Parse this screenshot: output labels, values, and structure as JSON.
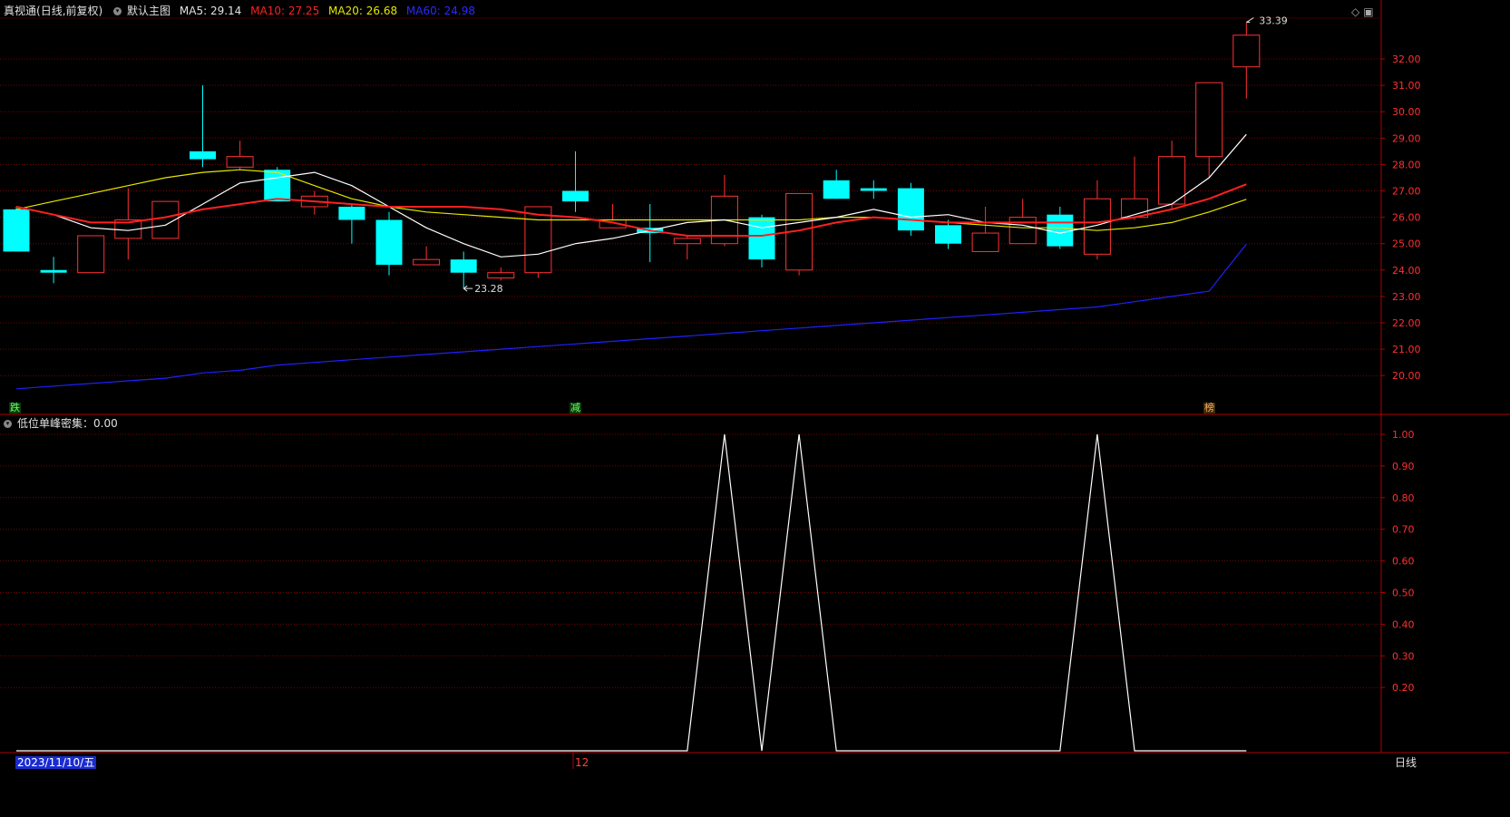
{
  "header": {
    "stock_name": "真视通",
    "adjust_mode": "(日线,前复权)",
    "template_name": "默认主图",
    "ma5_label": "MA5:",
    "ma5_value": "29.14",
    "ma10_label": "MA10:",
    "ma10_value": "27.25",
    "ma20_label": "MA20:",
    "ma20_value": "26.68",
    "ma60_label": "MA60:",
    "ma60_value": "24.98"
  },
  "indicator": {
    "label": "低位单峰密集：0.00"
  },
  "annotations": {
    "high_label": "33.39",
    "low_label": "23.28"
  },
  "signals": {
    "s1": "跌",
    "s2": "减",
    "s3": "榜"
  },
  "footer": {
    "date": "2023/11/10/五",
    "month_tick": "12",
    "period": "日线"
  },
  "colors": {
    "background": "#000000",
    "up": "#ff3232",
    "down": "#00ffff",
    "ma5": "#ffffff",
    "ma10": "#ff2020",
    "ma20": "#e6e600",
    "ma60": "#2020ff",
    "grid": "#7a0000",
    "axis": "#b00000"
  },
  "chart_data": {
    "type": "candlestick",
    "price_axis": {
      "ticks": [
        "32.00",
        "31.00",
        "30.00",
        "29.00",
        "28.00",
        "27.00",
        "26.00",
        "25.00",
        "24.00",
        "23.00",
        "22.00",
        "21.00",
        "20.00"
      ]
    },
    "indicator_axis": {
      "ticks": [
        "1.00",
        "0.90",
        "0.80",
        "0.70",
        "0.60",
        "0.50",
        "0.40",
        "0.30",
        "0.20"
      ]
    },
    "candles": [
      {
        "o": 26.3,
        "h": 26.4,
        "l": 24.7,
        "c": 24.7
      },
      {
        "o": 24.0,
        "h": 24.5,
        "l": 23.5,
        "c": 23.9
      },
      {
        "o": 23.9,
        "h": 25.3,
        "l": 23.9,
        "c": 25.3
      },
      {
        "o": 25.2,
        "h": 27.1,
        "l": 24.4,
        "c": 25.9
      },
      {
        "o": 25.2,
        "h": 26.6,
        "l": 25.2,
        "c": 26.6
      },
      {
        "o": 28.5,
        "h": 31.0,
        "l": 27.9,
        "c": 28.2
      },
      {
        "o": 27.9,
        "h": 28.9,
        "l": 27.8,
        "c": 28.3
      },
      {
        "o": 27.8,
        "h": 27.9,
        "l": 26.6,
        "c": 26.6
      },
      {
        "o": 26.4,
        "h": 27.0,
        "l": 26.1,
        "c": 26.8
      },
      {
        "o": 26.4,
        "h": 26.5,
        "l": 25.0,
        "c": 25.9
      },
      {
        "o": 25.9,
        "h": 26.2,
        "l": 23.8,
        "c": 24.2
      },
      {
        "o": 24.2,
        "h": 24.9,
        "l": 24.2,
        "c": 24.4
      },
      {
        "o": 24.4,
        "h": 24.7,
        "l": 23.3,
        "c": 23.9
      },
      {
        "o": 23.7,
        "h": 24.1,
        "l": 23.6,
        "c": 23.9
      },
      {
        "o": 23.9,
        "h": 26.4,
        "l": 23.7,
        "c": 26.4
      },
      {
        "o": 27.0,
        "h": 28.5,
        "l": 26.2,
        "c": 26.6
      },
      {
        "o": 25.6,
        "h": 26.5,
        "l": 25.6,
        "c": 25.9
      },
      {
        "o": 25.6,
        "h": 26.5,
        "l": 24.3,
        "c": 25.4
      },
      {
        "o": 25.0,
        "h": 25.3,
        "l": 24.4,
        "c": 25.2
      },
      {
        "o": 25.0,
        "h": 27.6,
        "l": 24.9,
        "c": 26.8
      },
      {
        "o": 26.0,
        "h": 26.1,
        "l": 24.1,
        "c": 24.4
      },
      {
        "o": 24.0,
        "h": 26.9,
        "l": 23.8,
        "c": 26.9
      },
      {
        "o": 27.4,
        "h": 27.8,
        "l": 26.7,
        "c": 26.7
      },
      {
        "o": 27.1,
        "h": 27.4,
        "l": 26.7,
        "c": 27.0
      },
      {
        "o": 27.1,
        "h": 27.3,
        "l": 25.3,
        "c": 25.5
      },
      {
        "o": 25.7,
        "h": 25.9,
        "l": 24.8,
        "c": 25.0
      },
      {
        "o": 24.7,
        "h": 26.4,
        "l": 24.7,
        "c": 25.4
      },
      {
        "o": 25.0,
        "h": 26.7,
        "l": 25.0,
        "c": 26.0
      },
      {
        "o": 26.1,
        "h": 26.4,
        "l": 24.8,
        "c": 24.9
      },
      {
        "o": 24.6,
        "h": 27.4,
        "l": 24.4,
        "c": 26.7
      },
      {
        "o": 26.0,
        "h": 28.3,
        "l": 25.9,
        "c": 26.7
      },
      {
        "o": 26.5,
        "h": 28.9,
        "l": 26.3,
        "c": 28.3
      },
      {
        "o": 28.3,
        "h": 31.1,
        "l": 27.5,
        "c": 31.1
      },
      {
        "o": 31.7,
        "h": 33.39,
        "l": 30.5,
        "c": 32.9
      }
    ],
    "ma5": [
      26.4,
      26.1,
      25.6,
      25.5,
      25.7,
      26.5,
      27.3,
      27.5,
      27.7,
      27.2,
      26.4,
      25.6,
      25.0,
      24.5,
      24.6,
      25.0,
      25.2,
      25.5,
      25.8,
      25.9,
      25.6,
      25.8,
      26.0,
      26.3,
      26.0,
      26.1,
      25.8,
      25.7,
      25.4,
      25.7,
      26.1,
      26.5,
      27.5,
      29.14
    ],
    "ma10": [
      26.4,
      26.1,
      25.8,
      25.8,
      26.0,
      26.3,
      26.5,
      26.7,
      26.6,
      26.5,
      26.4,
      26.4,
      26.4,
      26.3,
      26.1,
      26.0,
      25.8,
      25.5,
      25.3,
      25.3,
      25.3,
      25.5,
      25.8,
      26.0,
      25.9,
      25.8,
      25.8,
      25.8,
      25.8,
      25.8,
      26.0,
      26.3,
      26.7,
      27.25
    ],
    "ma20": [
      26.3,
      26.6,
      26.9,
      27.2,
      27.5,
      27.7,
      27.8,
      27.7,
      27.2,
      26.7,
      26.4,
      26.2,
      26.1,
      26.0,
      25.9,
      25.9,
      25.9,
      25.9,
      25.9,
      25.9,
      25.9,
      25.9,
      26.0,
      26.0,
      25.9,
      25.8,
      25.7,
      25.6,
      25.6,
      25.5,
      25.6,
      25.8,
      26.2,
      26.68
    ],
    "ma60": [
      19.5,
      19.6,
      19.7,
      19.8,
      19.9,
      20.1,
      20.2,
      20.4,
      20.5,
      20.6,
      20.7,
      20.8,
      20.9,
      21.0,
      21.1,
      21.2,
      21.3,
      21.4,
      21.5,
      21.6,
      21.7,
      21.8,
      21.9,
      22.0,
      22.1,
      22.2,
      22.3,
      22.4,
      22.5,
      22.6,
      22.8,
      23.0,
      23.2,
      24.98
    ],
    "indicator_values": [
      0,
      0,
      0,
      0,
      0,
      0,
      0,
      0,
      0,
      0,
      0,
      0,
      0,
      0,
      0,
      0,
      0,
      0,
      0,
      1,
      0,
      1,
      0,
      0,
      0,
      0,
      0,
      0,
      0,
      1,
      0,
      0,
      0,
      0
    ]
  }
}
